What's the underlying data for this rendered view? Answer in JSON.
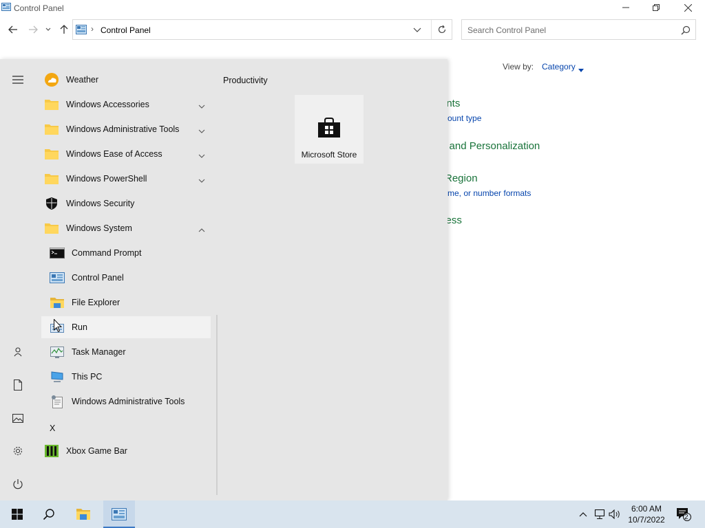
{
  "window": {
    "title": "Control Panel",
    "address": {
      "crumb": "Control Panel"
    },
    "search": {
      "placeholder": "Search Control Panel"
    },
    "view_by": {
      "label": "View by:",
      "value": "Category"
    },
    "partial_links": [
      {
        "text": "unts",
        "style": "large"
      },
      {
        "text": "count type",
        "style": "small"
      },
      {
        "text": "e and Personalization",
        "style": "large"
      },
      {
        "text": "Region",
        "style": "large"
      },
      {
        "text": "time, or number formats",
        "style": "small"
      },
      {
        "text": "cess",
        "style": "large"
      }
    ]
  },
  "start_menu": {
    "apps": [
      {
        "label": "Weather",
        "icon": "weather-icon",
        "expandable": false
      },
      {
        "label": "Windows Accessories",
        "icon": "folder-icon",
        "expandable": true,
        "expanded": false
      },
      {
        "label": "Windows Administrative Tools",
        "icon": "folder-icon",
        "expandable": true,
        "expanded": false
      },
      {
        "label": "Windows Ease of Access",
        "icon": "folder-icon",
        "expandable": true,
        "expanded": false
      },
      {
        "label": "Windows PowerShell",
        "icon": "folder-icon",
        "expandable": true,
        "expanded": false
      },
      {
        "label": "Windows Security",
        "icon": "shield-icon",
        "expandable": false
      },
      {
        "label": "Windows System",
        "icon": "folder-icon",
        "expandable": true,
        "expanded": true
      },
      {
        "label": "Command Prompt",
        "icon": "command-prompt-icon",
        "child": true
      },
      {
        "label": "Control Panel",
        "icon": "control-panel-icon",
        "child": true
      },
      {
        "label": "File Explorer",
        "icon": "file-explorer-icon",
        "child": true
      },
      {
        "label": "Run",
        "icon": "run-icon",
        "child": true,
        "hovered": true
      },
      {
        "label": "Task Manager",
        "icon": "task-manager-icon",
        "child": true
      },
      {
        "label": "This PC",
        "icon": "this-pc-icon",
        "child": true
      },
      {
        "label": "Windows Administrative Tools",
        "icon": "admin-tools-icon",
        "child": true
      }
    ],
    "letter_header": "X",
    "apps_after_letter": [
      {
        "label": "Xbox Game Bar",
        "icon": "xbox-game-bar-icon"
      }
    ],
    "tile_group": {
      "title": "Productivity",
      "tiles": [
        {
          "label": "Microsoft Store",
          "icon": "microsoft-store-icon"
        }
      ]
    },
    "rail_icons": [
      "hamburger-menu-icon",
      "user-icon",
      "documents-icon",
      "pictures-icon",
      "settings-gear-icon",
      "power-icon"
    ]
  },
  "taskbar": {
    "buttons": [
      "windows-start-icon",
      "search-icon",
      "file-explorer-icon",
      "control-panel-icon"
    ],
    "active_button": "control-panel-icon",
    "tray": [
      "chevron-up-icon",
      "network-icon",
      "volume-icon"
    ],
    "clock": {
      "time": "6:00 AM",
      "date": "10/7/2022"
    },
    "notifications": {
      "count": "2"
    }
  },
  "colors": {
    "start_menu_bg": "#e6e6e6",
    "taskbar_bg": "#d9e4ee",
    "category_green": "#19733a",
    "link_blue": "#0645ad"
  }
}
